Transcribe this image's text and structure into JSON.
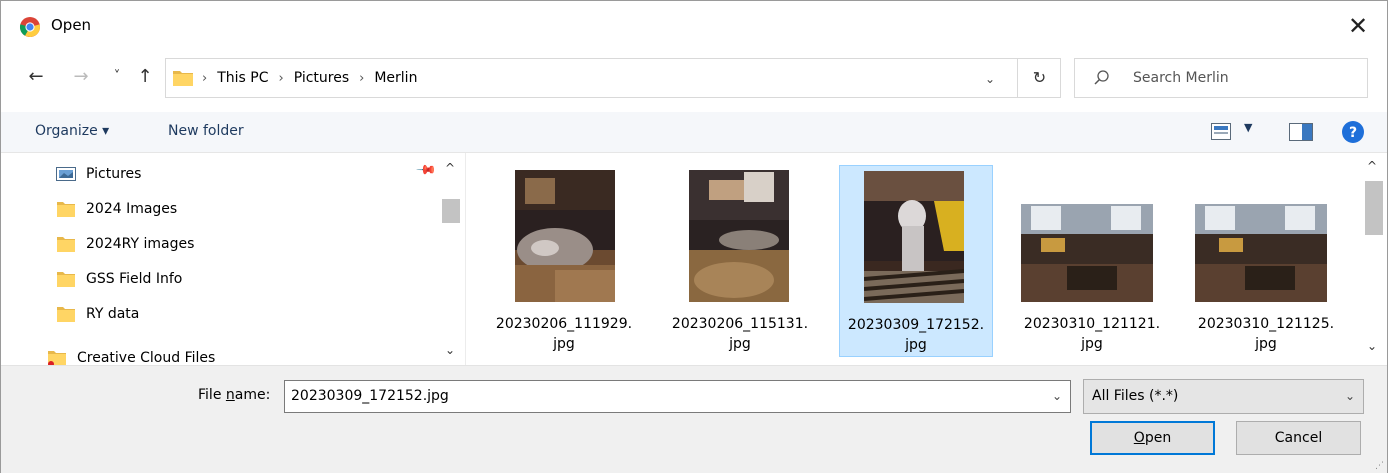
{
  "window": {
    "title": "Open",
    "close_label": "✕"
  },
  "nav": {
    "back": "←",
    "forward": "→",
    "recent": "˅",
    "up": "↑"
  },
  "address": {
    "crumbs": [
      "This PC",
      "Pictures",
      "Merlin"
    ],
    "separator": "›",
    "dropdown": "⌄",
    "refresh": "↻"
  },
  "search": {
    "placeholder": "Search Merlin"
  },
  "toolbar": {
    "organize_label": "Organize ▾",
    "new_folder_label": "New folder",
    "view_dropdown": "▼"
  },
  "sidebar": {
    "items": [
      {
        "label": "Pictures",
        "icon": "pictures-icon"
      },
      {
        "label": "2024 Images",
        "icon": "folder-icon"
      },
      {
        "label": "2024RY images",
        "icon": "folder-icon"
      },
      {
        "label": "GSS Field Info",
        "icon": "folder-icon"
      },
      {
        "label": "RY data",
        "icon": "folder-icon"
      },
      {
        "label": "Creative Cloud Files",
        "icon": "creative-cloud-icon"
      }
    ],
    "pin": "📌",
    "scroll_up": "^",
    "scroll_down": "⌄"
  },
  "files": [
    {
      "line1": "20230206_111929.",
      "line2": "jpg",
      "selected": false
    },
    {
      "line1": "20230206_115131.",
      "line2": "jpg",
      "selected": false
    },
    {
      "line1": "20230309_172152.",
      "line2": "jpg",
      "selected": true
    },
    {
      "line1": "20230310_121121.",
      "line2": "jpg",
      "selected": false
    },
    {
      "line1": "20230310_121125.",
      "line2": "jpg",
      "selected": false
    }
  ],
  "content_scroll": {
    "up": "^",
    "down": "⌄"
  },
  "bottom": {
    "file_name_label_pre": "File ",
    "file_name_label_u": "n",
    "file_name_label_post": "ame:",
    "file_name_value": "20230309_172152.jpg",
    "file_name_dropdown": "⌄",
    "file_type_value": "All Files (*.*)",
    "file_type_dropdown": "⌄",
    "open_label_u": "O",
    "open_label_rest": "pen",
    "cancel_label": "Cancel",
    "grip": "⋰"
  },
  "colors": {
    "accent": "#0078d7",
    "selection": "#cce8ff",
    "folder": "#ffd564",
    "help": "#1e6fd9"
  }
}
